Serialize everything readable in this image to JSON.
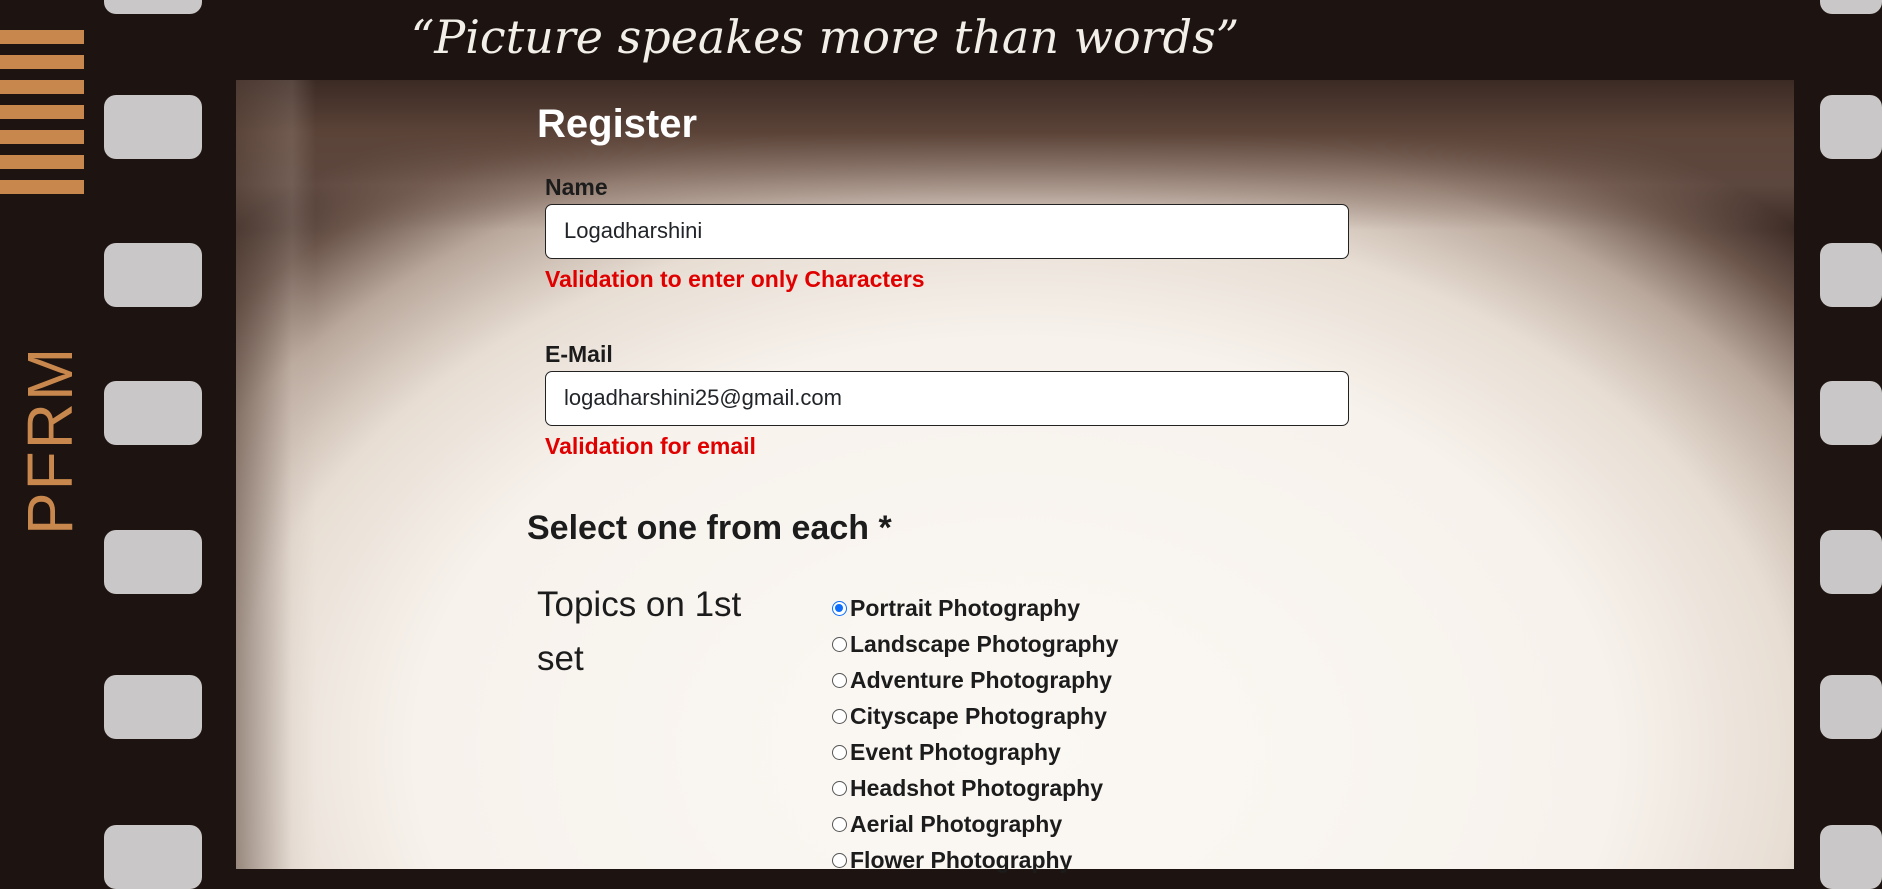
{
  "brand": {
    "text": "PFRM",
    "color": "#c8874c"
  },
  "quote": "“Picture speakes more than words”",
  "form": {
    "title": "Register",
    "name": {
      "label": "Name",
      "value": "Logadharshini",
      "error": "Validation to enter only Characters"
    },
    "email": {
      "label": "E-Mail",
      "value": "logadharshini25@gmail.com",
      "error": "Validation for email"
    },
    "select_heading": "Select one from each *",
    "topic_label": "Topics on 1st set",
    "options": [
      {
        "label": "Portrait Photography",
        "checked": true
      },
      {
        "label": "Landscape Photography",
        "checked": false
      },
      {
        "label": "Adventure Photography",
        "checked": false
      },
      {
        "label": "Cityscape Photography",
        "checked": false
      },
      {
        "label": "Event Photography",
        "checked": false
      },
      {
        "label": "Headshot Photography",
        "checked": false
      },
      {
        "label": "Aerial Photography",
        "checked": false
      },
      {
        "label": "Flower Photography",
        "checked": false
      }
    ]
  },
  "colors": {
    "error": "#e00000",
    "accent": "#0d6efd",
    "film": "#1d1310"
  }
}
